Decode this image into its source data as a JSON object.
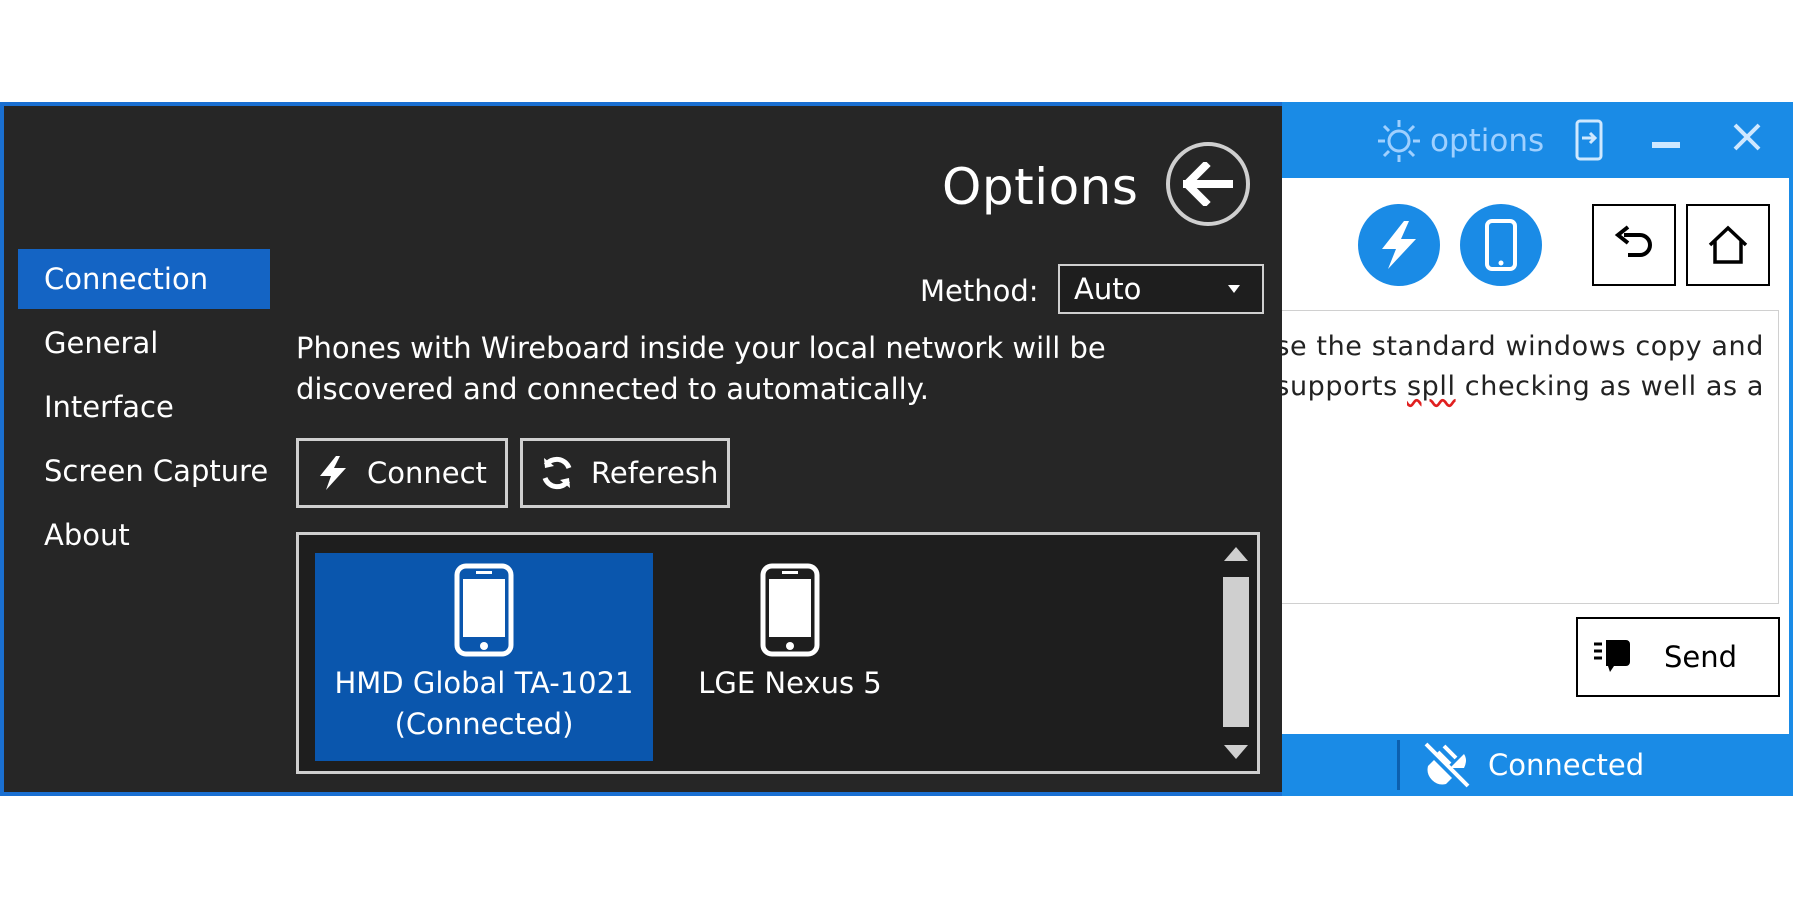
{
  "options_panel": {
    "title": "Options",
    "sidebar": {
      "items": [
        {
          "label": "Connection",
          "active": true
        },
        {
          "label": "General"
        },
        {
          "label": "Interface"
        },
        {
          "label": "Screen Capture"
        },
        {
          "label": "About"
        }
      ]
    },
    "method": {
      "label": "Method:",
      "selected": "Auto"
    },
    "description": "Phones with Wireboard inside your local network will be discovered and connected to automatically.",
    "buttons": {
      "connect": "Connect",
      "refresh": "Referesh"
    },
    "devices": [
      {
        "name": "HMD Global TA-1021",
        "status": "(Connected)",
        "selected": true
      },
      {
        "name": "LGE Nexus 5",
        "status": ""
      }
    ]
  },
  "main_window": {
    "titlebar": {
      "options_label": "options"
    },
    "text_lines": [
      {
        "before": "se the standard windows copy and",
        "misspelled": "",
        "after": ""
      },
      {
        "before": "supports ",
        "misspelled": "spll",
        "after": " checking as well as a"
      }
    ],
    "send_label": "Send",
    "status": "Connected"
  },
  "colors": {
    "accent_blue": "#1a8be6",
    "selected_blue": "#0a56ad",
    "sidebar_active": "#1464c4",
    "dark_bg": "#262626"
  },
  "icons": {
    "back": "arrow-left-icon",
    "connect": "flash-icon",
    "refresh": "refresh-icon",
    "device": "smartphone-icon",
    "settings": "gear-icon",
    "undo": "undo-icon",
    "home": "home-icon",
    "send": "send-hand-icon",
    "status": "disconnect-plug-icon",
    "close": "close-icon",
    "minimize": "minimize-icon"
  }
}
